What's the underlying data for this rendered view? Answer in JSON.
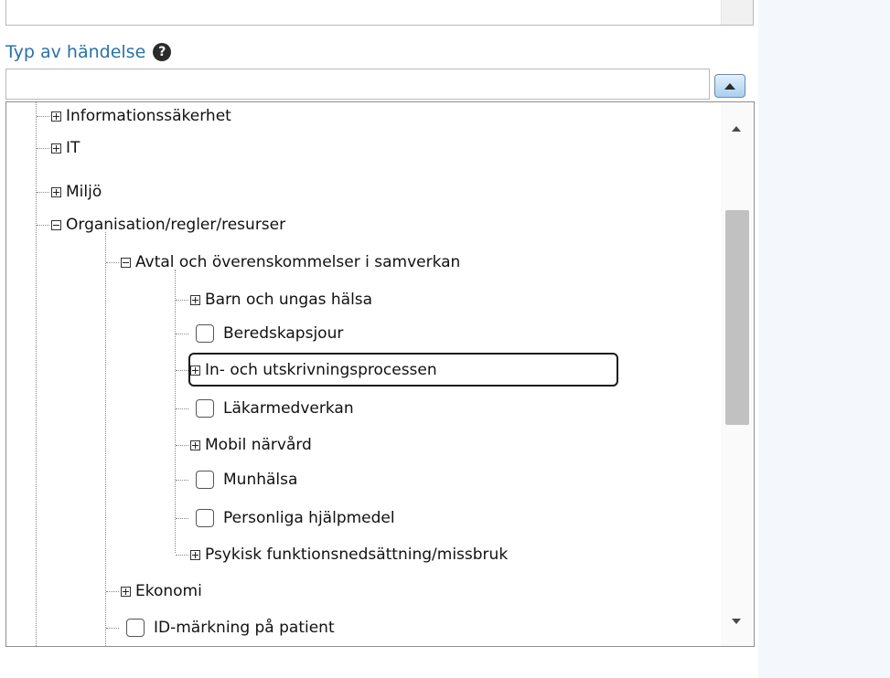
{
  "field": {
    "label": "Typ av händelse",
    "help_icon": "question-circle-icon",
    "input_value": "",
    "toggle_icon": "triangle-up-icon"
  },
  "tree": {
    "items": [
      {
        "label": "Informationssäkerhet",
        "type": "expander-plus"
      },
      {
        "label": "IT",
        "type": "expander-plus"
      },
      {
        "label": "Miljö",
        "type": "expander-plus"
      },
      {
        "label": "Organisation/regler/resurser",
        "type": "expander-minus"
      },
      {
        "label": "Avtal och överenskommelser i samverkan",
        "type": "expander-minus"
      },
      {
        "label": "Barn och ungas hälsa",
        "type": "expander-plus"
      },
      {
        "label": "Beredskapsjour",
        "type": "checkbox",
        "checked": false
      },
      {
        "label": "In- och utskrivningsprocessen",
        "type": "expander-plus",
        "focused": true
      },
      {
        "label": "Läkarmedverkan",
        "type": "checkbox",
        "checked": false
      },
      {
        "label": "Mobil närvård",
        "type": "expander-plus"
      },
      {
        "label": "Munhälsa",
        "type": "checkbox",
        "checked": false
      },
      {
        "label": "Personliga hjälpmedel",
        "type": "checkbox",
        "checked": false
      },
      {
        "label": "Psykisk funktionsnedsättning/missbruk",
        "type": "expander-plus"
      },
      {
        "label": "Ekonomi",
        "type": "expander-plus"
      },
      {
        "label": "ID-märkning på patient",
        "type": "checkbox",
        "checked": false
      }
    ]
  },
  "colors": {
    "label": "#2a72a8",
    "toggle_gradient_top": "#e3f1fc",
    "toggle_gradient_bottom": "#a9cfee"
  }
}
